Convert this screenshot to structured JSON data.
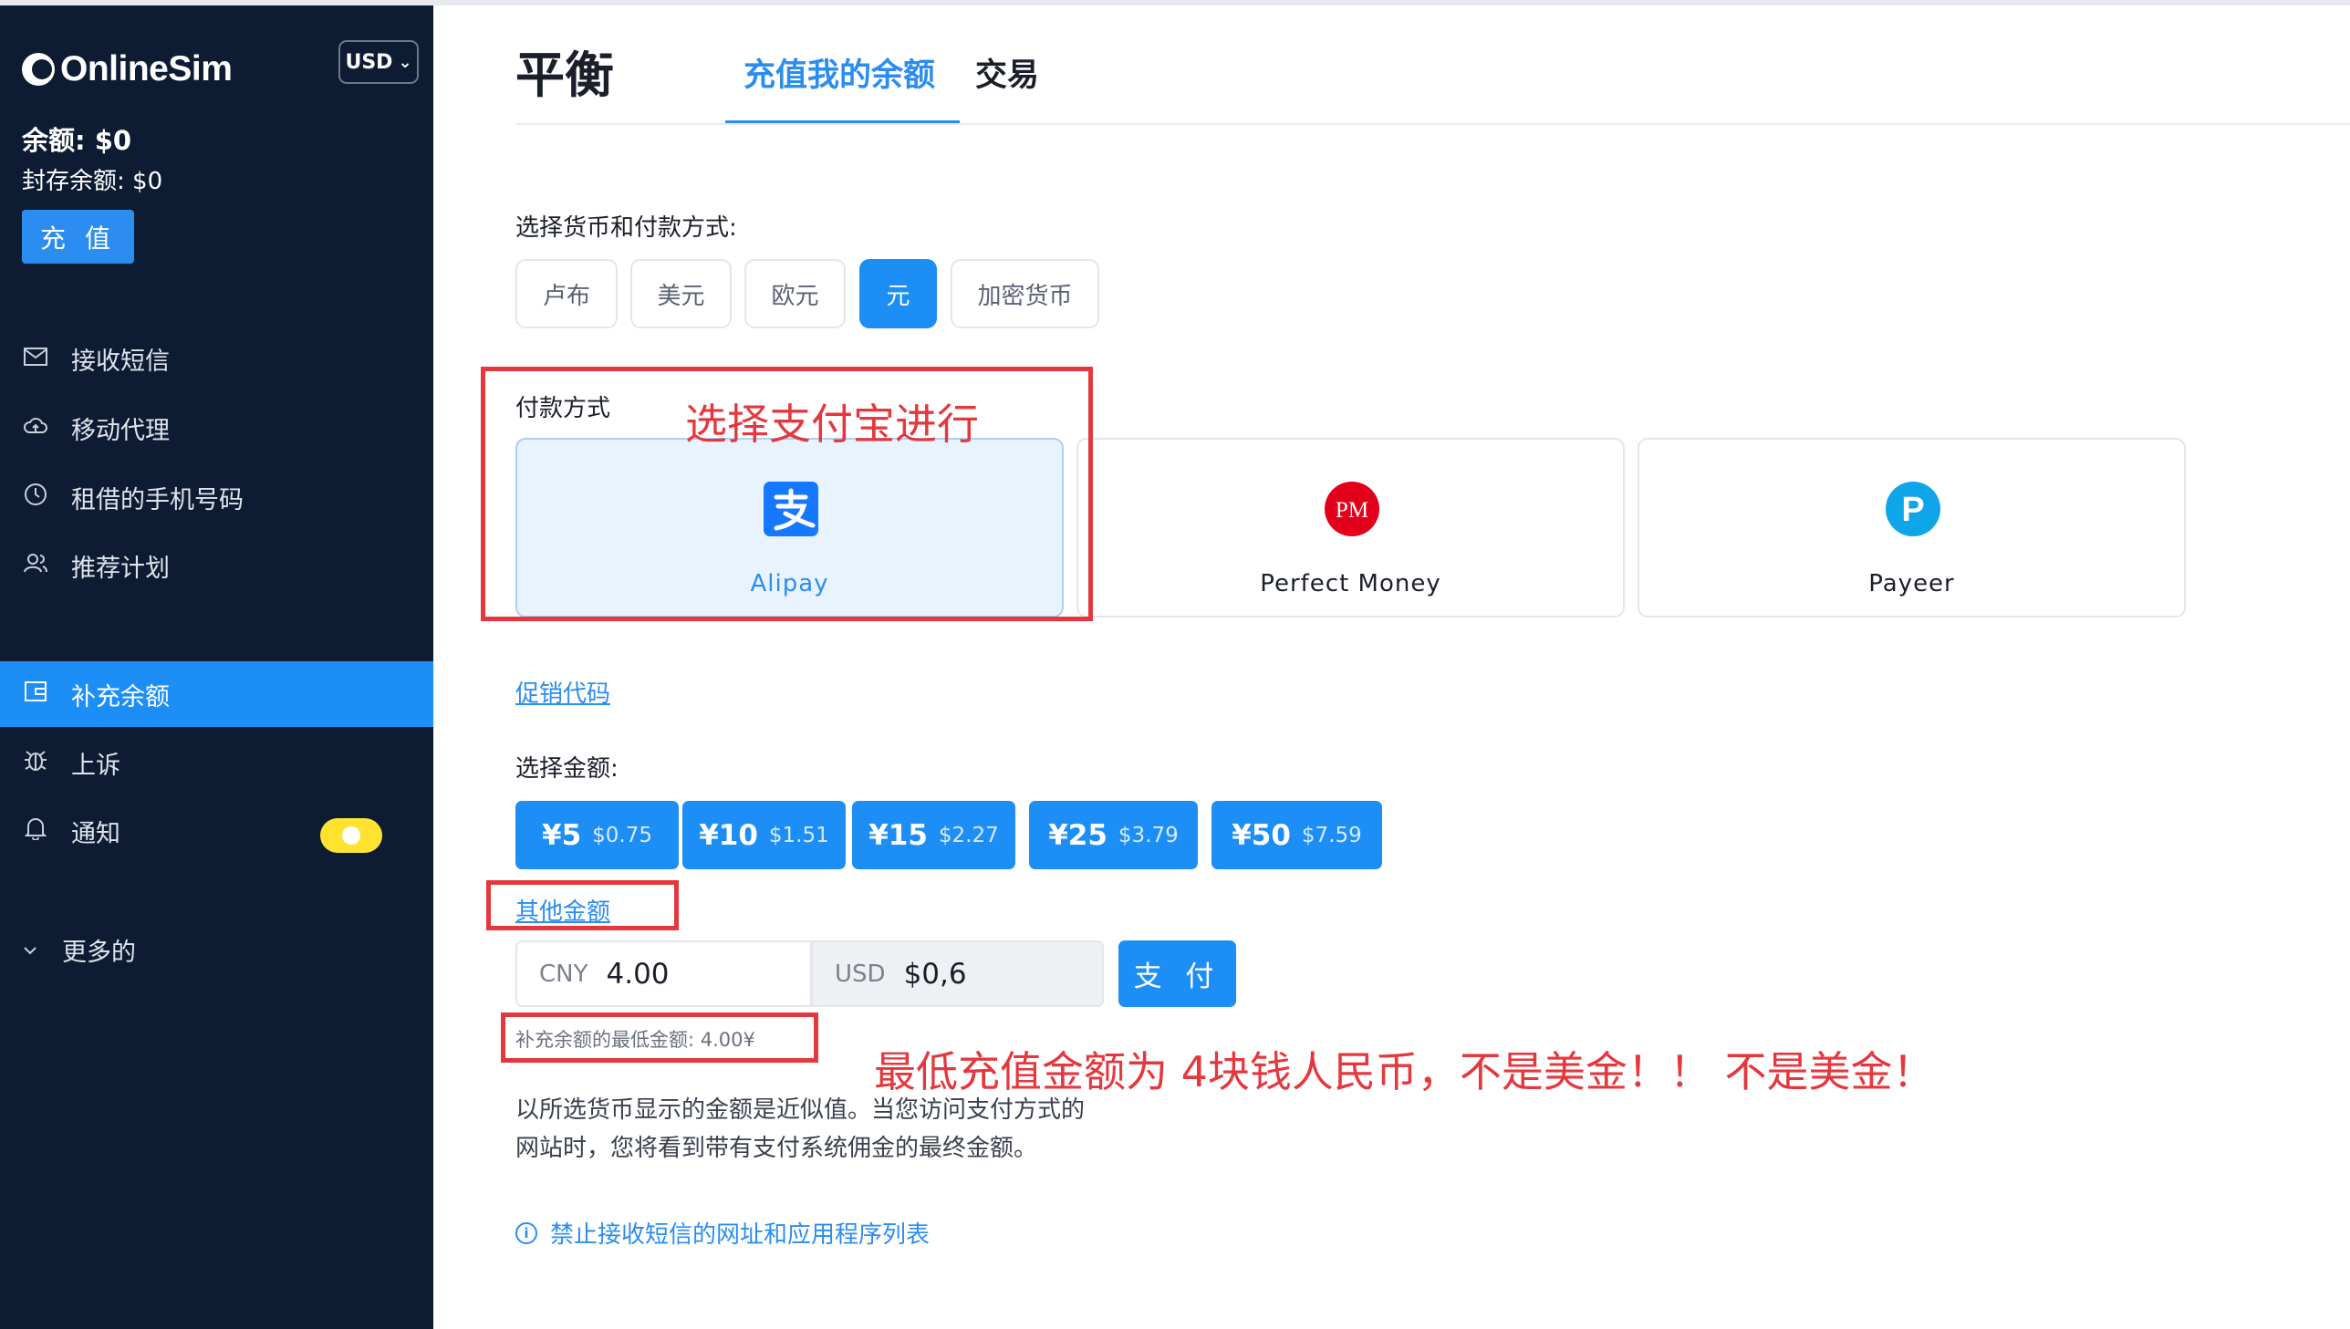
{
  "app": {
    "brand": "OnlineSim",
    "currency_selector": "USD"
  },
  "sidebar": {
    "balance": "余额: $0",
    "frozen_balance": "封存余额: $0",
    "recharge_label": "充 值",
    "nav": [
      {
        "label": "接收短信",
        "icon": "mail-icon"
      },
      {
        "label": "移动代理",
        "icon": "cloud-icon"
      },
      {
        "label": "租借的手机号码",
        "icon": "clock-icon"
      },
      {
        "label": "推荐计划",
        "icon": "users-icon"
      },
      {
        "label": "补充余额",
        "icon": "wallet-icon",
        "active": true
      },
      {
        "label": "上诉",
        "icon": "bug-icon"
      },
      {
        "label": "通知",
        "icon": "bell-icon"
      },
      {
        "label": "更多的",
        "icon": "chevron-down-icon"
      }
    ],
    "notifications_toggle": true
  },
  "header": {
    "title": "平衡",
    "tabs": [
      {
        "label": "充值我的余额",
        "active": true
      },
      {
        "label": "交易",
        "active": false
      }
    ]
  },
  "main": {
    "currency_prompt": "选择货币和付款方式:",
    "currencies": [
      {
        "label": "卢布",
        "selected": false
      },
      {
        "label": "美元",
        "selected": false
      },
      {
        "label": "欧元",
        "selected": false
      },
      {
        "label": "元",
        "selected": true
      },
      {
        "label": "加密货币",
        "selected": false
      }
    ],
    "payment_label": "付款方式",
    "payment_methods": [
      {
        "name": "Alipay",
        "icon": "alipay-icon",
        "selected": true
      },
      {
        "name": "Perfect Money",
        "icon": "perfect-money-icon",
        "logo_text": "PM",
        "selected": false
      },
      {
        "name": "Payeer",
        "icon": "payeer-icon",
        "logo_text": "P",
        "selected": false
      }
    ],
    "promo_link": "促销代码",
    "amount_prompt": "选择金额:",
    "amounts": [
      {
        "main": "¥5",
        "sub": "$0.75"
      },
      {
        "main": "¥10",
        "sub": "$1.51"
      },
      {
        "main": "¥15",
        "sub": "$2.27"
      },
      {
        "main": "¥25",
        "sub": "$3.79"
      },
      {
        "main": "¥50",
        "sub": "$7.59"
      }
    ],
    "other_amount_link": "其他金额",
    "cny_prefix": "CNY",
    "cny_value": "4.00",
    "usd_prefix": "USD",
    "usd_value": "$0,6",
    "pay_button": "支 付",
    "min_note": "补充余额的最低金额: 4.00¥",
    "description_line1": "以所选货币显示的金额是近似值。当您访问支付方式的",
    "description_line2": "网站时，您将看到带有支付系统佣金的最终金额。",
    "forbidden_link": "禁止接收短信的网址和应用程序列表"
  },
  "annotations": {
    "alipay_note": "选择支付宝进行",
    "min_note": "最低充值金额为 4块钱人民币，不是美金！！ 不是美金！",
    "color": "#e5373e"
  },
  "colors": {
    "sidebar": "#0e1c33",
    "accent": "#1d8ef5",
    "toggle": "#ffe32e"
  }
}
